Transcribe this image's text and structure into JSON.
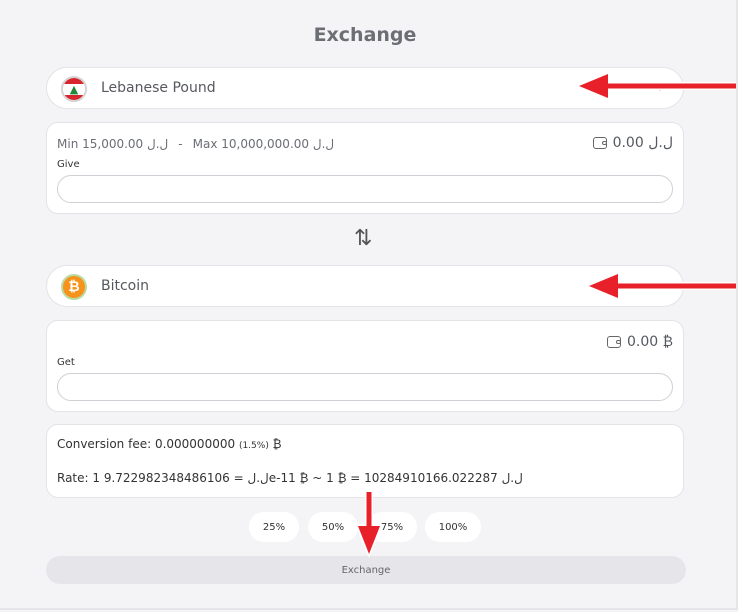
{
  "page": {
    "title": "Exchange"
  },
  "from_currency": {
    "name": "Lebanese Pound",
    "icon": "lebanon-flag-icon"
  },
  "give": {
    "min_label": "Min 15,000.00 ل.ل",
    "separator": "-",
    "max_label": "Max 10,000,000.00 ل.ل",
    "balance": "0.00 ل.ل",
    "field_label": "Give",
    "value": ""
  },
  "swap": {
    "icon": "swap-arrows-icon",
    "glyph": "⇅"
  },
  "to_currency": {
    "name": "Bitcoin",
    "icon": "bitcoin-icon",
    "symbol": "₿"
  },
  "get": {
    "balance": "0.00 ₿",
    "field_label": "Get",
    "value": ""
  },
  "info": {
    "fee_prefix": "Conversion fee: 0.000000000",
    "fee_percent": "(1.5%)",
    "fee_suffix": "₿",
    "rate": "Rate: 1 ل.ل = 9.722982348486106e-11 ₿ ~ 1 ₿ = 10284910166.022287 ل.ل"
  },
  "percent_buttons": [
    "25%",
    "50%",
    "75%",
    "100%"
  ],
  "exchange_button": "Exchange",
  "colors": {
    "annotation_arrow": "#e8202a",
    "bitcoin": "#f7931a",
    "flag_red": "#d8262e",
    "cedar_green": "#1f8a3b"
  }
}
